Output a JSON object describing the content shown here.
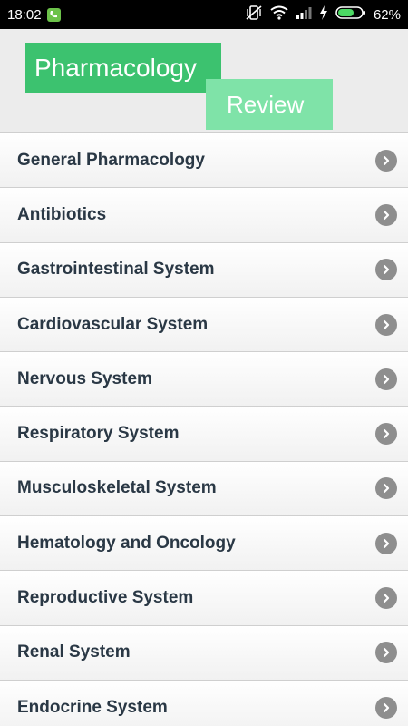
{
  "status": {
    "time": "18:02",
    "battery": "62%"
  },
  "header": {
    "logo_line1": "Pharmacology",
    "logo_line2": "Review"
  },
  "menu": {
    "items": [
      {
        "label": "General Pharmacology"
      },
      {
        "label": "Antibiotics"
      },
      {
        "label": "Gastrointestinal System"
      },
      {
        "label": "Cardiovascular System"
      },
      {
        "label": "Nervous System"
      },
      {
        "label": "Respiratory System"
      },
      {
        "label": "Musculoskeletal System"
      },
      {
        "label": "Hematology and Oncology"
      },
      {
        "label": "Reproductive System"
      },
      {
        "label": "Renal System"
      },
      {
        "label": "Endocrine System"
      }
    ]
  }
}
